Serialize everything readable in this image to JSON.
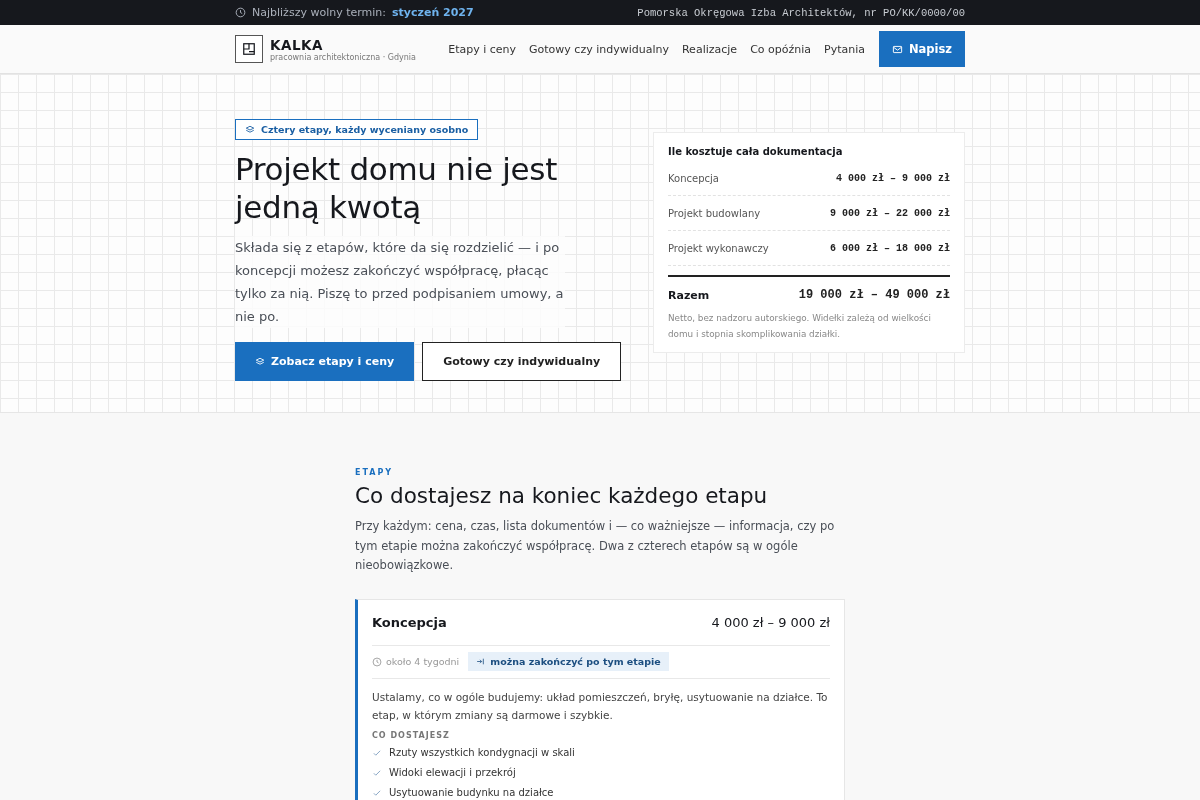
{
  "top_bar": {
    "label": "Najbliższy wolny termin:",
    "value": "styczeń 2027",
    "registration": "Pomorska Okręgowa Izba Architektów, nr PO/KK/0000/00"
  },
  "header": {
    "logo": "KALKA",
    "tagline": "pracownia architektoniczna · Gdynia",
    "nav": [
      "Etapy i ceny",
      "Gotowy czy indywidualny",
      "Realizacje",
      "Co opóźnia",
      "Pytania"
    ],
    "cta": "Napisz"
  },
  "hero": {
    "badge": "Cztery etapy, każdy wyceniany osobno",
    "title": "Projekt domu nie jest jedną kwotą",
    "lead": "Składa się z etapów, które da się rozdzielić — i po koncepcji możesz zakończyć współpracę, płacąc tylko za nią. Piszę to przed podpisaniem umowy, a nie po.",
    "buttons": [
      {
        "label": "Zobacz etapy i ceny",
        "kind": "primary"
      },
      {
        "label": "Gotowy czy indywidualny",
        "kind": "secondary"
      }
    ]
  },
  "price_card": {
    "title": "Ile kosztuje cała dokumentacja",
    "rows": [
      {
        "name": "Koncepcja",
        "price": "4 000 zł – 9 000 zł"
      },
      {
        "name": "Projekt budowlany",
        "price": "9 000 zł – 22 000 zł"
      },
      {
        "name": "Projekt wykonawczy",
        "price": "6 000 zł – 18 000 zł"
      }
    ],
    "total": {
      "label": "Razem",
      "price": "19 000 zł – 49 000 zł"
    },
    "note": "Netto, bez nadzoru autorskiego. Widełki zależą od wielkości domu i stopnia skomplikowania działki."
  },
  "stages": {
    "eyebrow": "ETAPY",
    "title": "Co dostajesz na koniec każdego etapu",
    "intro": "Przy każdym: cena, czas, lista dokumentów i — co ważniejsze — informacja, czy po tym etapie można zakończyć współpracę. Dwa z czterech etapów są w ogóle nieobowiązkowe.",
    "items": [
      {
        "name": "Koncepcja",
        "price": "4 000 zł – 9 000 zł",
        "duration": "około 4 tygodni",
        "exit": "można zakończyć po tym etapie",
        "description": "Ustalamy, co w ogóle budujemy: układ pomieszczeń, bryłę, usytuowanie na działce. To etap, w którym zmiany są darmowe i szybkie.",
        "deliverables_label": "CO DOSTAJESZ",
        "deliverables": [
          "Rzuty wszystkich kondygnacji w skali",
          "Widoki elewacji i przekrój",
          "Usytuowanie budynku na działce"
        ]
      }
    ]
  }
}
